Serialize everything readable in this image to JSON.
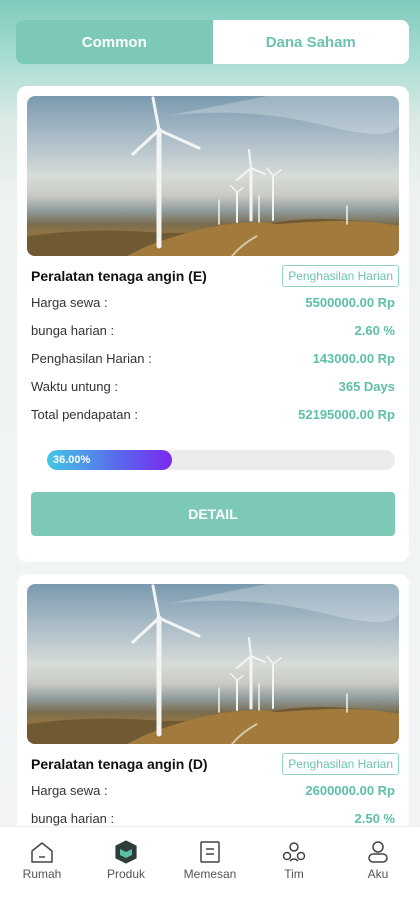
{
  "tabs": [
    {
      "label": "Common",
      "active": true
    },
    {
      "label": "Dana Saham",
      "active": false
    }
  ],
  "colors": {
    "accent": "#7cc9b8",
    "value_text": "#5cbfa8",
    "progress_start": "#43c7e6",
    "progress_end": "#7a2af0"
  },
  "products": [
    {
      "name": "Peralatan tenaga angin (E)",
      "badge": "Penghasilan Harian",
      "rows": [
        {
          "label": "Harga sewa :",
          "value": "5500000.00 Rp"
        },
        {
          "label": "bunga harian :",
          "value": "2.60 %"
        },
        {
          "label": "Penghasilan Harian :",
          "value": "143000.00 Rp"
        },
        {
          "label": "Waktu untung :",
          "value": "365 Days"
        },
        {
          "label": "Total pendapatan :",
          "value": "52195000.00 Rp"
        }
      ],
      "progress_label": "36.00%",
      "progress": 36,
      "button": "DETAIL"
    },
    {
      "name": "Peralatan tenaga angin (D)",
      "badge": "Penghasilan Harian",
      "rows": [
        {
          "label": "Harga sewa :",
          "value": "2600000.00 Rp"
        },
        {
          "label": "bunga harian :",
          "value": "2.50 %"
        }
      ]
    }
  ],
  "nav": [
    {
      "label": "Rumah",
      "icon": "home-icon"
    },
    {
      "label": "Produk",
      "icon": "box-icon",
      "active": true
    },
    {
      "label": "Memesan",
      "icon": "order-icon"
    },
    {
      "label": "Tim",
      "icon": "team-icon"
    },
    {
      "label": "Aku",
      "icon": "user-icon"
    }
  ]
}
